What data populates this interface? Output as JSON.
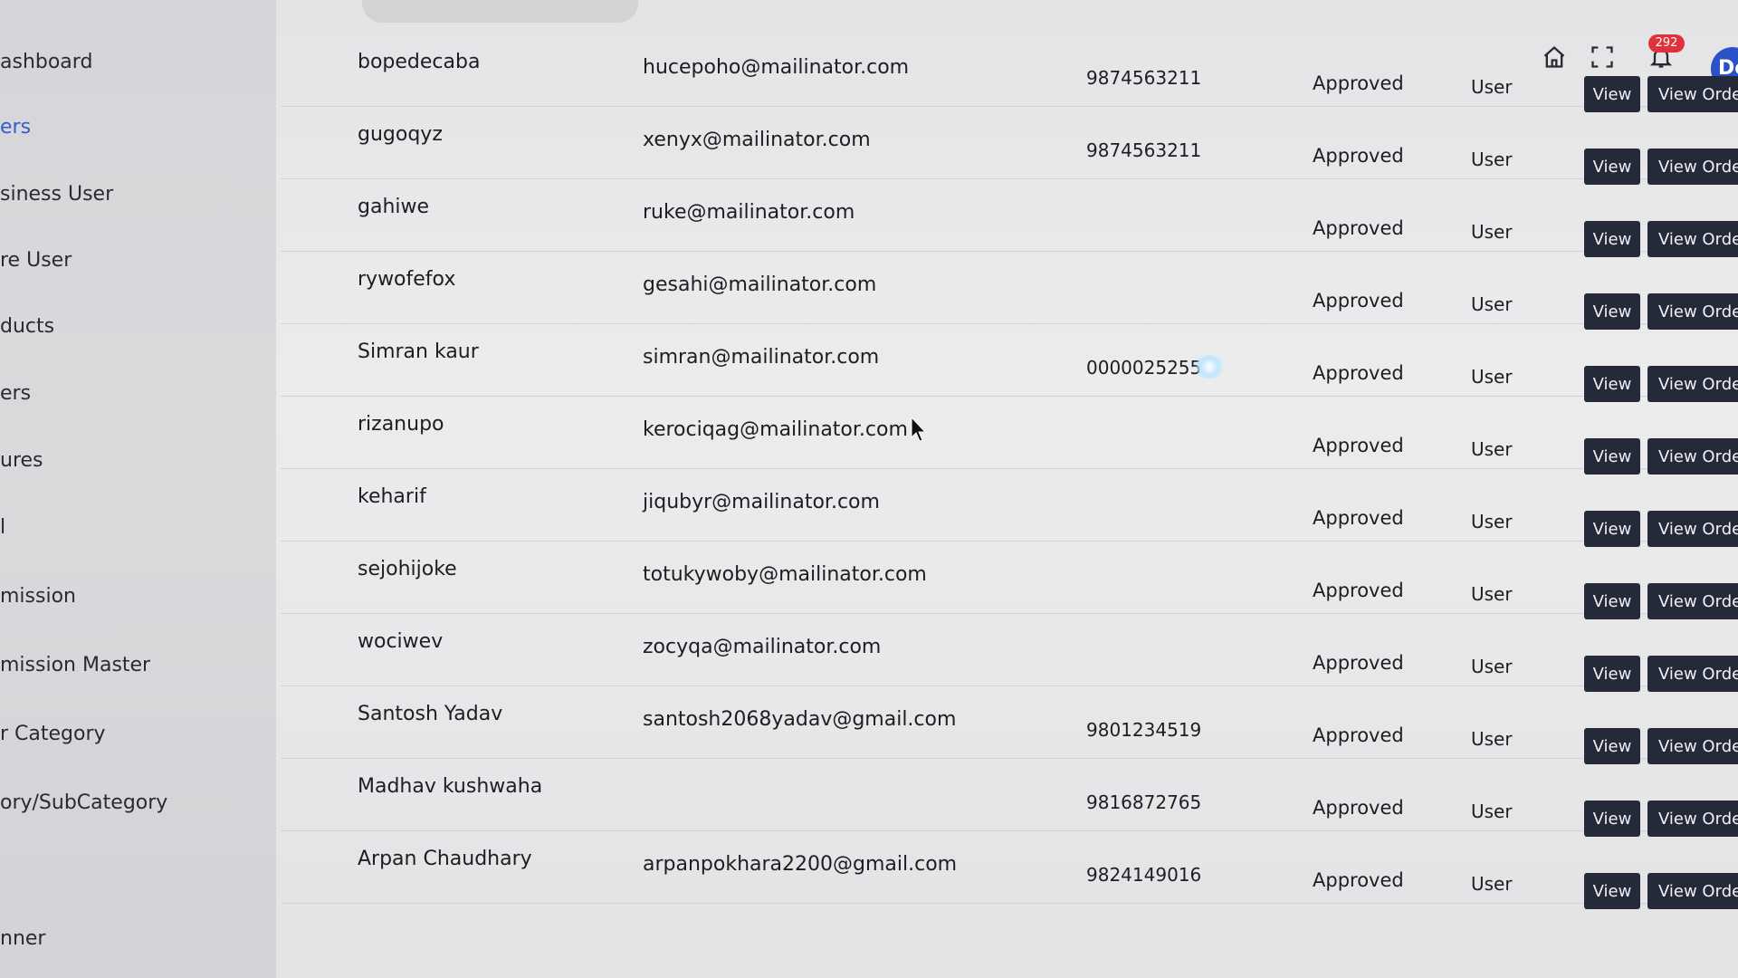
{
  "sidebar": {
    "items": [
      {
        "label": "ashboard",
        "active": false
      },
      {
        "label": "ers",
        "active": true
      },
      {
        "label": "siness User",
        "active": false
      },
      {
        "label": "re User",
        "active": false
      },
      {
        "label": "ducts",
        "active": false
      },
      {
        "label": "ers",
        "active": false
      },
      {
        "label": "ures",
        "active": false
      },
      {
        "label": "l",
        "active": false
      },
      {
        "label": "mission",
        "active": false
      },
      {
        "label": "mission Master",
        "active": false
      },
      {
        "label": "r Category",
        "active": false
      },
      {
        "label": "ory/SubCategory",
        "active": false
      },
      {
        "label": "nner",
        "active": false
      }
    ]
  },
  "header": {
    "icons": [
      "home-icon",
      "fullscreen-icon",
      "bell-icon"
    ],
    "notification_count": "292",
    "avatar_text": "De"
  },
  "buttons": {
    "view": "View",
    "view_order": "View Order"
  },
  "rows": [
    {
      "name": "bopedecaba",
      "email": "hucepoho@mailinator.com",
      "phone": "9874563211",
      "status": "Approved",
      "role": "User"
    },
    {
      "name": "gugoqyz",
      "email": "xenyx@mailinator.com",
      "phone": "9874563211",
      "status": "Approved",
      "role": "User"
    },
    {
      "name": "gahiwe",
      "email": "ruke@mailinator.com",
      "phone": "",
      "status": "Approved",
      "role": "User"
    },
    {
      "name": "rywofefox",
      "email": "gesahi@mailinator.com",
      "phone": "",
      "status": "Approved",
      "role": "User"
    },
    {
      "name": "Simran kaur",
      "email": "simran@mailinator.com",
      "phone": "0000025255",
      "status": "Approved",
      "role": "User"
    },
    {
      "name": "rizanupo",
      "email": "kerociqag@mailinator.com",
      "phone": "",
      "status": "Approved",
      "role": "User"
    },
    {
      "name": "keharif",
      "email": "jiqubyr@mailinator.com",
      "phone": "",
      "status": "Approved",
      "role": "User"
    },
    {
      "name": "sejohijoke",
      "email": "totukywoby@mailinator.com",
      "phone": "",
      "status": "Approved",
      "role": "User"
    },
    {
      "name": "wociwev",
      "email": "zocyqa@mailinator.com",
      "phone": "",
      "status": "Approved",
      "role": "User"
    },
    {
      "name": "Santosh Yadav",
      "email": "santosh2068yadav@gmail.com",
      "phone": "9801234519",
      "status": "Approved",
      "role": "User"
    },
    {
      "name": "Madhav kushwaha",
      "email": "",
      "phone": "9816872765",
      "status": "Approved",
      "role": "User"
    },
    {
      "name": "Arpan Chaudhary",
      "email": "arpanpokhara2200@gmail.com",
      "phone": "9824149016",
      "status": "Approved",
      "role": "User"
    }
  ]
}
